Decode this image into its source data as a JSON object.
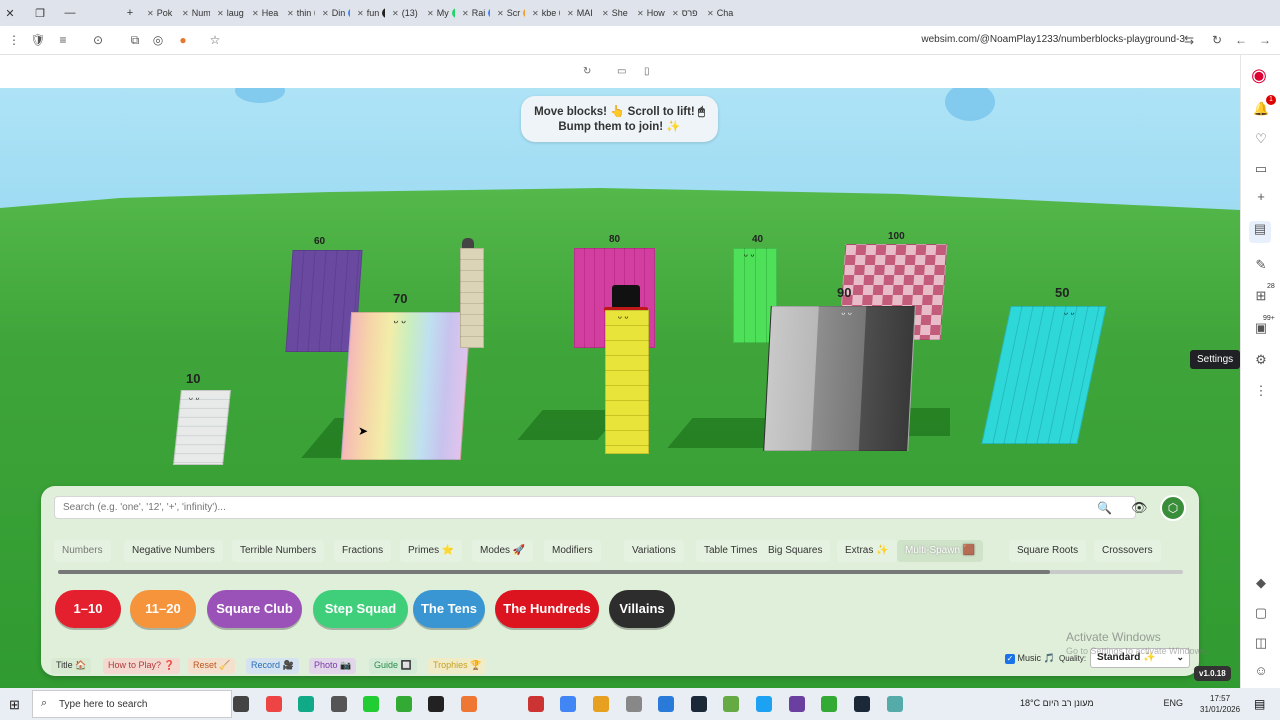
{
  "browser": {
    "tabs": [
      "Pok",
      "Num",
      "laug",
      "Hea",
      "thin",
      "Din",
      "fun",
      "(13)",
      "My",
      "Rai",
      "Scr",
      "kbe",
      "MAI",
      "She",
      "How",
      "פרס",
      "Cha"
    ],
    "url": "websim.com/@NoamPlay1233/numberblocks-playground-3",
    "tooltip": "Settings",
    "notif_badge": "1",
    "badge_28": "28",
    "badge_99": "99+"
  },
  "hint": {
    "line1": "Move blocks! 👆 Scroll to lift! 🖱",
    "line2": "Bump them to join! ✨"
  },
  "blocks": {
    "b10": "10",
    "b60": "60",
    "b70": "70",
    "b80": "80",
    "b40": "40",
    "b100": "100",
    "b90": "90",
    "b50": "50"
  },
  "search": {
    "placeholder": "Search (e.g. 'one', '12', '+', 'infinity')..."
  },
  "categories": [
    "Numbers",
    "Negative Numbers",
    "Terrible Numbers",
    "Fractions",
    "Primes ⭐",
    "Modes 🚀",
    "Modifiers",
    "Variations",
    "Table Times",
    "Big Squares",
    "Extras ✨",
    "Multi-Spawn 🟫",
    "Square Roots",
    "Crossovers"
  ],
  "groups": [
    {
      "label": "1–10",
      "color": "#e4202f"
    },
    {
      "label": "11–20",
      "color": "#f5943a"
    },
    {
      "label": "Square Club",
      "color": "#9b52b8"
    },
    {
      "label": "Step Squad",
      "color": "#3fcf7a"
    },
    {
      "label": "The Tens",
      "color": "#3a96d3"
    },
    {
      "label": "The Hundreds",
      "color": "#dc141f"
    },
    {
      "label": "Villains",
      "color": "#2d2d2d"
    }
  ],
  "footer": {
    "title": "Title 🏠",
    "howto": "How to Play? ❓",
    "reset": "Reset 🧹",
    "record": "Record 🎥",
    "photo": "Photo 📷",
    "guide": "Guide 🔲",
    "trophies": "Trophies 🏆",
    "music": "Music 🎵",
    "quality_label": "Quality:",
    "quality_value": "Standard ✨",
    "version": "v1.0.18"
  },
  "watermark": {
    "line1": "Activate Windows",
    "line2": "Go to Settings to activate Windows."
  },
  "taskbar": {
    "search": "Type here to search",
    "weather": "18°C  מעונן רב היום",
    "lang": "ENG",
    "time": "17:57",
    "date": "31/01/2026"
  }
}
